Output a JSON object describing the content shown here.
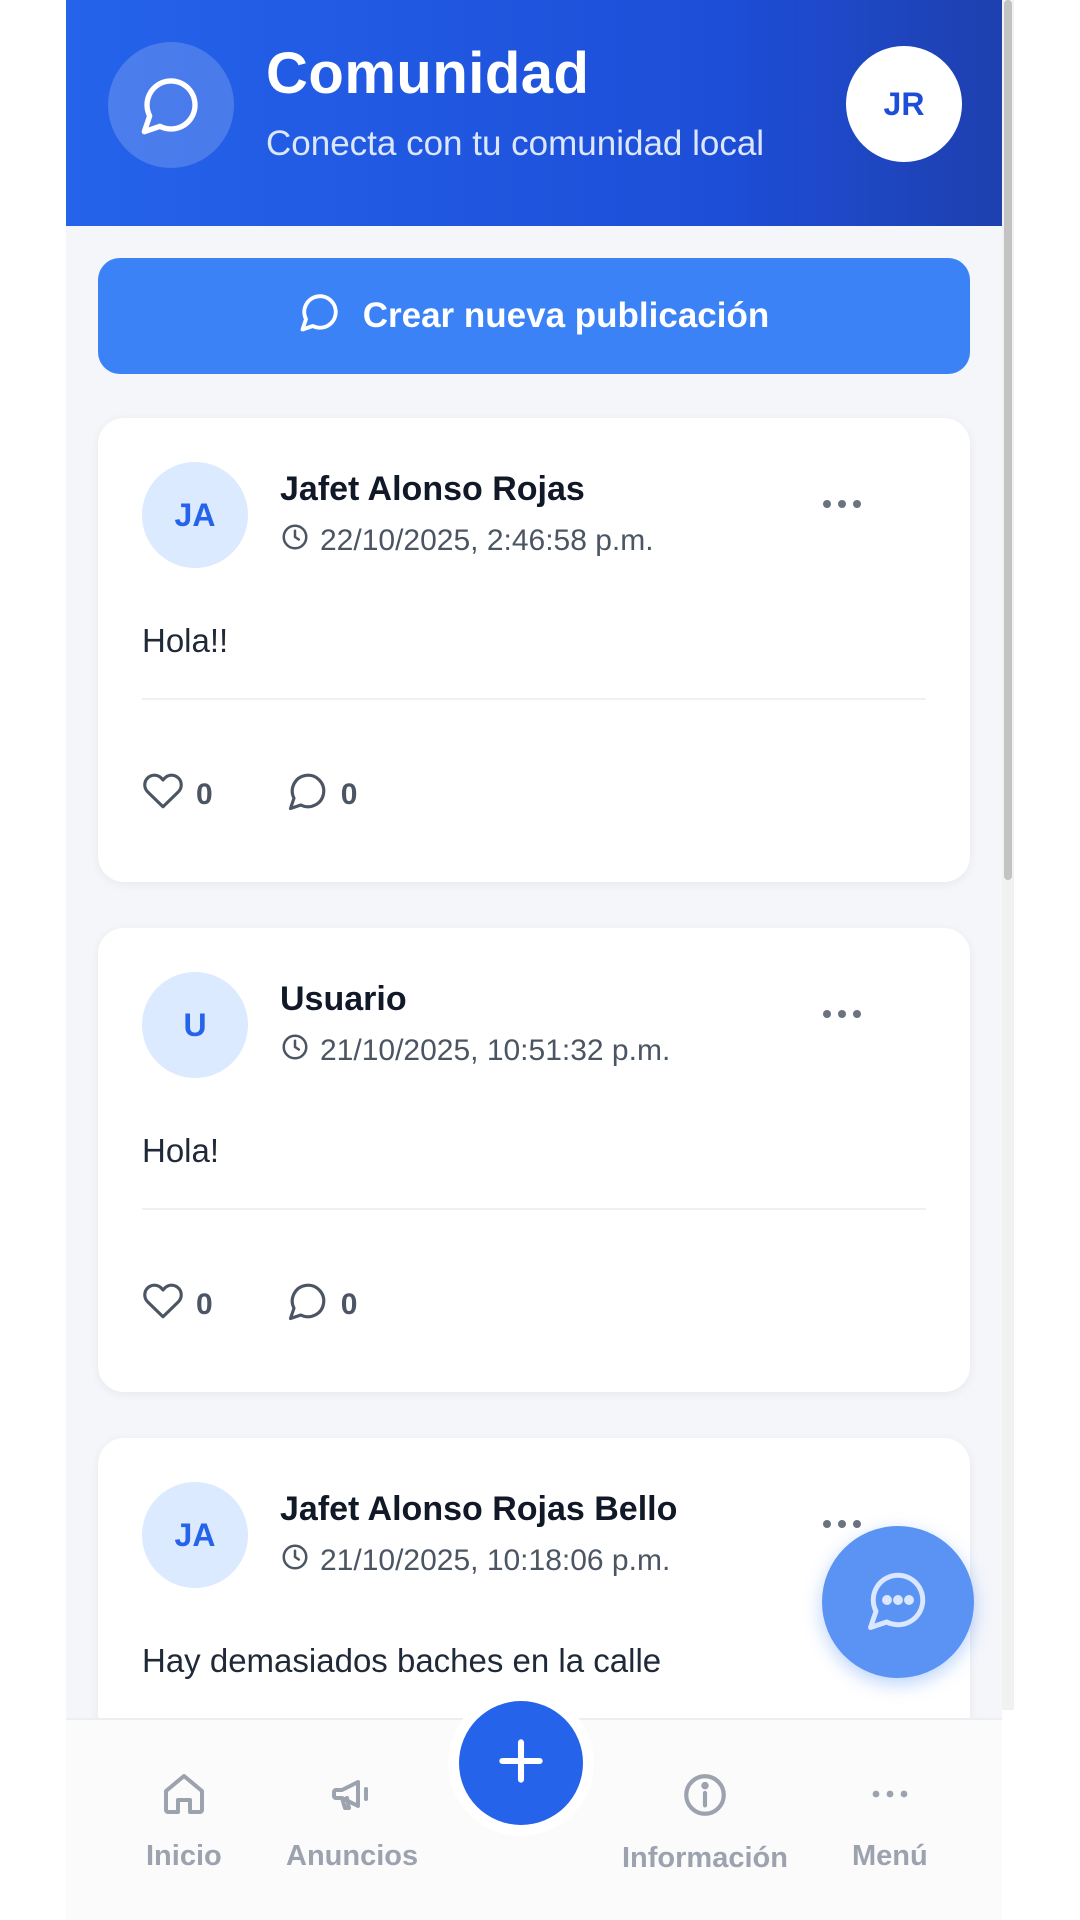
{
  "header": {
    "title": "Comunidad",
    "subtitle": "Conecta con tu comunidad local",
    "avatar_initials": "JR",
    "icon": "chat-bubble-icon"
  },
  "create_post": {
    "label": "Crear nueva publicación",
    "icon": "chat-bubble-icon"
  },
  "posts": [
    {
      "initials": "JA",
      "author": "Jafet Alonso Rojas",
      "timestamp": "22/10/2025, 2:46:58 p.m.",
      "content": "Hola!!",
      "likes": "0",
      "comments": "0"
    },
    {
      "initials": "U",
      "author": "Usuario",
      "timestamp": "21/10/2025, 10:51:32 p.m.",
      "content": "Hola!",
      "likes": "0",
      "comments": "0"
    },
    {
      "initials": "JA",
      "author": "Jafet Alonso Rojas Bello",
      "timestamp": "21/10/2025, 10:18:06 p.m.",
      "content": "Hay demasiados baches en la calle"
    }
  ],
  "bottom_nav": {
    "items": [
      {
        "label": "Inicio",
        "icon": "home-icon"
      },
      {
        "label": "Anuncios",
        "icon": "megaphone-icon"
      },
      {
        "label": "Información",
        "icon": "info-icon"
      },
      {
        "label": "Menú",
        "icon": "more-horizontal-icon"
      }
    ],
    "center_icon": "plus-icon"
  },
  "colors": {
    "header": "#2563eb",
    "primary_button": "#3b82f6",
    "avatar_bg": "#dbeafe",
    "fab": "#5b93f4"
  }
}
